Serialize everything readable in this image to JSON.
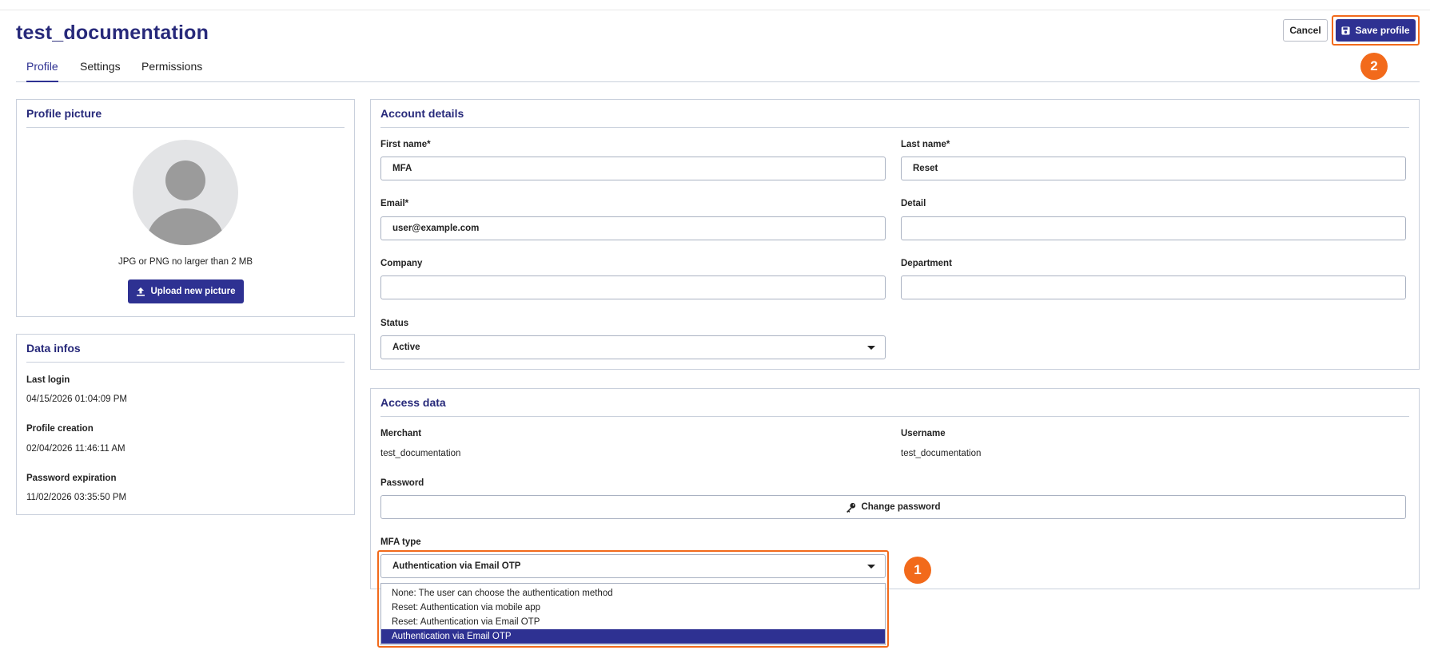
{
  "header": {
    "title": "test_documentation",
    "cancel_label": "Cancel",
    "save_label": "Save profile"
  },
  "tabs": [
    {
      "label": "Profile",
      "active": true
    },
    {
      "label": "Settings",
      "active": false
    },
    {
      "label": "Permissions",
      "active": false
    }
  ],
  "profile_picture": {
    "title": "Profile picture",
    "hint": "JPG or PNG no larger than 2 MB",
    "upload_label": "Upload new picture"
  },
  "data_infos": {
    "title": "Data infos",
    "last_login_label": "Last login",
    "last_login_value": "04/15/2026 01:04:09 PM",
    "profile_creation_label": "Profile creation",
    "profile_creation_value": "02/04/2026 11:46:11 AM",
    "password_expiration_label": "Password expiration",
    "password_expiration_value": "11/02/2026 03:35:50 PM"
  },
  "account_details": {
    "title": "Account details",
    "first_name_label": "First name*",
    "first_name_value": "MFA",
    "last_name_label": "Last name*",
    "last_name_value": "Reset",
    "email_label": "Email*",
    "email_value": "user@example.com",
    "detail_label": "Detail",
    "detail_value": "",
    "company_label": "Company",
    "company_value": "",
    "department_label": "Department",
    "department_value": "",
    "status_label": "Status",
    "status_value": "Active"
  },
  "access_data": {
    "title": "Access data",
    "merchant_label": "Merchant",
    "merchant_value": "test_documentation",
    "username_label": "Username",
    "username_value": "test_documentation",
    "password_label": "Password",
    "change_password_label": "Change password",
    "mfa_label": "MFA type",
    "mfa_value": "Authentication via Email OTP",
    "mfa_options": [
      "None: The user can choose the authentication method",
      "Reset: Authentication via mobile app",
      "Reset: Authentication via Email OTP",
      "Authentication via Email OTP"
    ],
    "mfa_selected_index": 3
  },
  "annotations": {
    "badge_1": "1",
    "badge_2": "2",
    "highlight_color": "#f26a1b"
  },
  "colors": {
    "primary": "#2e3192",
    "heading": "#27297a",
    "border": "#c9d0dc"
  },
  "icons": {
    "save": "floppy-disk-icon",
    "upload": "upload-icon",
    "key": "key-icon",
    "dropdown": "caret-down-icon",
    "avatar": "user-avatar-icon"
  }
}
